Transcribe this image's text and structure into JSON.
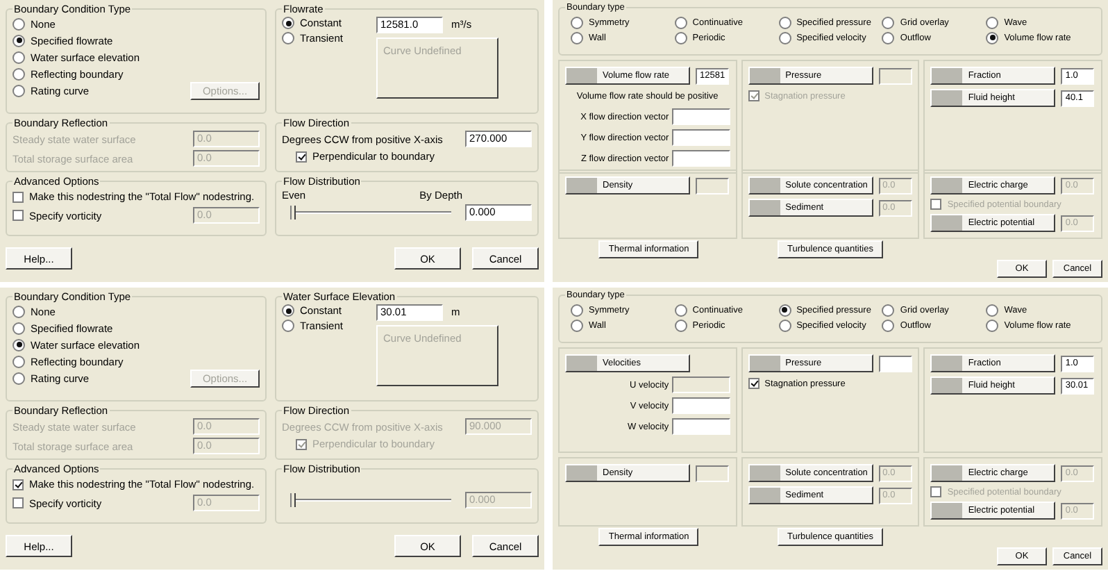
{
  "dialogs": [
    {
      "kind": "boundary_condition",
      "condition_type": {
        "title": "Boundary Condition Type",
        "options": [
          {
            "label": "None",
            "selected": false
          },
          {
            "label": "Specified flowrate",
            "selected": true
          },
          {
            "label": "Water surface elevation",
            "selected": false
          },
          {
            "label": "Reflecting boundary",
            "selected": false
          },
          {
            "label": "Rating curve",
            "selected": false
          }
        ],
        "options_button": {
          "label": "Options...",
          "disabled": true
        }
      },
      "value_group": {
        "title": "Flowrate",
        "modes": [
          {
            "label": "Constant",
            "selected": true
          },
          {
            "label": "Transient",
            "selected": false
          }
        ],
        "value": "12581.0",
        "units": "m³/s",
        "curve_button": "Curve Undefined"
      },
      "reflection": {
        "title": "Boundary Reflection",
        "disabled": true,
        "fields": [
          {
            "label": "Steady state water surface",
            "value": "0.0"
          },
          {
            "label": "Total storage surface area",
            "value": "0.0"
          }
        ]
      },
      "direction": {
        "title": "Flow Direction",
        "disabled": false,
        "label": "Degrees CCW from positive X-axis",
        "value": "270.000",
        "perpendicular": {
          "label": "Perpendicular to boundary",
          "checked": true
        }
      },
      "advanced": {
        "title": "Advanced Options",
        "total_flow": {
          "label": "Make this nodestring the \"Total Flow\" nodestring.",
          "checked": false
        },
        "vorticity": {
          "label": "Specify vorticity",
          "checked": false,
          "value": "0.0"
        }
      },
      "distribution": {
        "title": "Flow Distribution",
        "disabled": false,
        "even_label": "Even",
        "depth_label": "By Depth",
        "level": 0,
        "value": "0.000"
      },
      "buttons": [
        "Help...",
        "OK",
        "Cancel"
      ]
    },
    {
      "kind": "fluid_boundary",
      "boundary_type": {
        "title": "Boundary type",
        "options": [
          {
            "label": "Symmetry",
            "selected": false
          },
          {
            "label": "Continuative",
            "selected": false
          },
          {
            "label": "Specified pressure",
            "selected": false
          },
          {
            "label": "Grid overlay",
            "selected": false
          },
          {
            "label": "Wave",
            "selected": false
          },
          {
            "label": "Wall",
            "selected": false
          },
          {
            "label": "Periodic",
            "selected": false
          },
          {
            "label": "Specified velocity",
            "selected": false
          },
          {
            "label": "Outflow",
            "selected": false
          },
          {
            "label": "Volume flow rate",
            "selected": true
          }
        ]
      },
      "flow_panel": {
        "button": "Volume flow rate",
        "value": "12581",
        "note": "Volume flow rate should be positive",
        "vectors": [
          {
            "label": "X flow direction vector",
            "disabled": false
          },
          {
            "label": "Y flow direction vector",
            "disabled": false
          },
          {
            "label": "Z flow direction vector",
            "disabled": false
          }
        ]
      },
      "pressure_panel": {
        "button": "Pressure",
        "disabled": true,
        "stagnation": {
          "label": "Stagnation pressure",
          "checked": true,
          "disabled": true
        }
      },
      "fluid_panel": [
        {
          "button": "Fraction",
          "value": "1.0"
        },
        {
          "button": "Fluid height",
          "value": "40.1"
        }
      ],
      "density_panel": {
        "button": "Density"
      },
      "solute_panel": [
        {
          "button": "Solute concentration",
          "value": "0.0"
        },
        {
          "button": "Sediment",
          "value": "0.0"
        }
      ],
      "electric_panel": {
        "charge": {
          "button": "Electric charge",
          "value": "0.0"
        },
        "potential_boundary": {
          "label": "Specified potential boundary",
          "checked": false,
          "disabled": true
        },
        "potential": {
          "button": "Electric potential",
          "value": "0.0"
        }
      },
      "extra_buttons": [
        "Thermal information",
        "Turbulence quantities"
      ],
      "buttons": [
        "OK",
        "Cancel"
      ]
    },
    {
      "kind": "boundary_condition",
      "condition_type": {
        "title": "Boundary Condition Type",
        "options": [
          {
            "label": "None",
            "selected": false
          },
          {
            "label": "Specified flowrate",
            "selected": false
          },
          {
            "label": "Water surface elevation",
            "selected": true
          },
          {
            "label": "Reflecting boundary",
            "selected": false
          },
          {
            "label": "Rating curve",
            "selected": false
          }
        ],
        "options_button": {
          "label": "Options...",
          "disabled": true
        }
      },
      "value_group": {
        "title": "Water Surface Elevation",
        "modes": [
          {
            "label": "Constant",
            "selected": true
          },
          {
            "label": "Transient",
            "selected": false
          }
        ],
        "value": "30.01",
        "units": "m",
        "curve_button": "Curve Undefined"
      },
      "reflection": {
        "title": "Boundary Reflection",
        "disabled": true,
        "fields": [
          {
            "label": "Steady state water surface",
            "value": "0.0"
          },
          {
            "label": "Total storage surface area",
            "value": "0.0"
          }
        ]
      },
      "direction": {
        "title": "Flow Direction",
        "disabled": true,
        "label": "Degrees CCW from positive X-axis",
        "value": "90.000",
        "perpendicular": {
          "label": "Perpendicular to boundary",
          "checked": true
        }
      },
      "advanced": {
        "title": "Advanced Options",
        "total_flow": {
          "label": "Make this nodestring the \"Total Flow\" nodestring.",
          "checked": true
        },
        "vorticity": {
          "label": "Specify vorticity",
          "checked": false,
          "value": "0.0"
        }
      },
      "distribution": {
        "title": "Flow Distribution",
        "disabled": true,
        "level": 0,
        "value": "0.000"
      },
      "buttons": [
        "Help...",
        "OK",
        "Cancel"
      ]
    },
    {
      "kind": "fluid_boundary",
      "boundary_type": {
        "title": "Boundary type",
        "options": [
          {
            "label": "Symmetry",
            "selected": false
          },
          {
            "label": "Continuative",
            "selected": false
          },
          {
            "label": "Specified pressure",
            "selected": true
          },
          {
            "label": "Grid overlay",
            "selected": false
          },
          {
            "label": "Wave",
            "selected": false
          },
          {
            "label": "Wall",
            "selected": false
          },
          {
            "label": "Periodic",
            "selected": false
          },
          {
            "label": "Specified velocity",
            "selected": false
          },
          {
            "label": "Outflow",
            "selected": false
          },
          {
            "label": "Volume flow rate",
            "selected": false
          }
        ]
      },
      "flow_panel": {
        "button": "Velocities",
        "vectors": [
          {
            "label": "U velocity",
            "disabled": true
          },
          {
            "label": "V velocity",
            "disabled": false
          },
          {
            "label": "W velocity",
            "disabled": false
          }
        ]
      },
      "pressure_panel": {
        "button": "Pressure",
        "disabled": false,
        "stagnation": {
          "label": "Stagnation pressure",
          "checked": true,
          "disabled": false
        }
      },
      "fluid_panel": [
        {
          "button": "Fraction",
          "value": "1.0"
        },
        {
          "button": "Fluid height",
          "value": "30.01"
        }
      ],
      "density_panel": {
        "button": "Density"
      },
      "solute_panel": [
        {
          "button": "Solute concentration",
          "value": "0.0"
        },
        {
          "button": "Sediment",
          "value": "0.0"
        }
      ],
      "electric_panel": {
        "charge": {
          "button": "Electric charge",
          "value": "0.0"
        },
        "potential_boundary": {
          "label": "Specified potential boundary",
          "checked": false,
          "disabled": true
        },
        "potential": {
          "button": "Electric potential",
          "value": "0.0"
        }
      },
      "extra_buttons": [
        "Thermal information",
        "Turbulence quantities"
      ],
      "buttons": [
        "OK",
        "Cancel"
      ]
    }
  ]
}
